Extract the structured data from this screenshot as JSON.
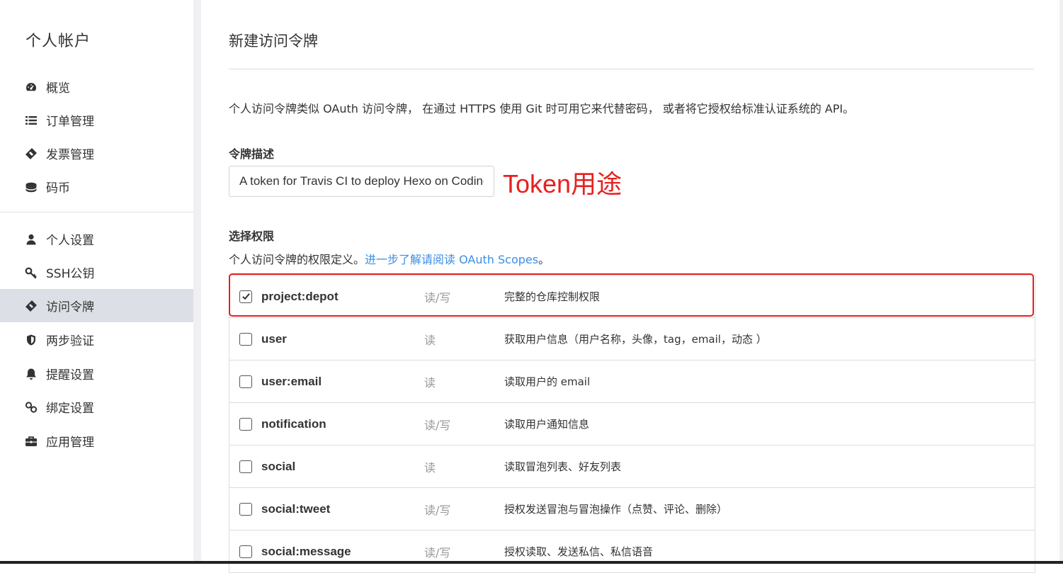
{
  "sidebar": {
    "title": "个人帐户",
    "items": [
      {
        "label": "概览",
        "icon": "dashboard-icon"
      },
      {
        "label": "订单管理",
        "icon": "list-icon"
      },
      {
        "label": "发票管理",
        "icon": "ticket-icon"
      },
      {
        "label": "码币",
        "icon": "coins-icon"
      },
      {
        "label": "个人设置",
        "icon": "user-icon"
      },
      {
        "label": "SSH公钥",
        "icon": "key-icon"
      },
      {
        "label": "访问令牌",
        "icon": "ticket-icon",
        "active": true
      },
      {
        "label": "两步验证",
        "icon": "shield-icon"
      },
      {
        "label": "提醒设置",
        "icon": "bell-icon"
      },
      {
        "label": "绑定设置",
        "icon": "link-icon"
      },
      {
        "label": "应用管理",
        "icon": "briefcase-icon"
      }
    ]
  },
  "main": {
    "title": "新建访问令牌",
    "intro": "个人访问令牌类似 OAuth 访问令牌， 在通过 HTTPS 使用 Git 时可用它来代替密码， 或者将它授权给标准认证系统的 API。",
    "token_label": "令牌描述",
    "token_value": "A token for Travis CI to deploy Hexo on Coding",
    "annotation": "Token用途",
    "scopes_label": "选择权限",
    "scopes_help_prefix": "个人访问令牌的权限定义。",
    "scopes_help_link": "进一步了解请阅读 OAuth Scopes",
    "scopes_help_suffix": "。",
    "scopes": [
      {
        "name": "project:depot",
        "perm": "读/写",
        "desc": "完整的仓库控制权限",
        "checked": true
      },
      {
        "name": "user",
        "perm": "读",
        "desc": "获取用户信息（用户名称，头像，tag，email，动态 ）",
        "checked": false
      },
      {
        "name": "user:email",
        "perm": "读",
        "desc": "读取用户的 email",
        "checked": false
      },
      {
        "name": "notification",
        "perm": "读/写",
        "desc": "读取用户通知信息",
        "checked": false
      },
      {
        "name": "social",
        "perm": "读",
        "desc": "读取冒泡列表、好友列表",
        "checked": false
      },
      {
        "name": "social:tweet",
        "perm": "读/写",
        "desc": "授权发送冒泡与冒泡操作（点赞、评论、删除）",
        "checked": false
      },
      {
        "name": "social:message",
        "perm": "读/写",
        "desc": "授权读取、发送私信、私信语音",
        "checked": false
      }
    ]
  },
  "colors": {
    "accent_link": "#3a8ee6",
    "annotation_red": "#e8201e",
    "active_nav_bg": "#dcdfe6"
  }
}
